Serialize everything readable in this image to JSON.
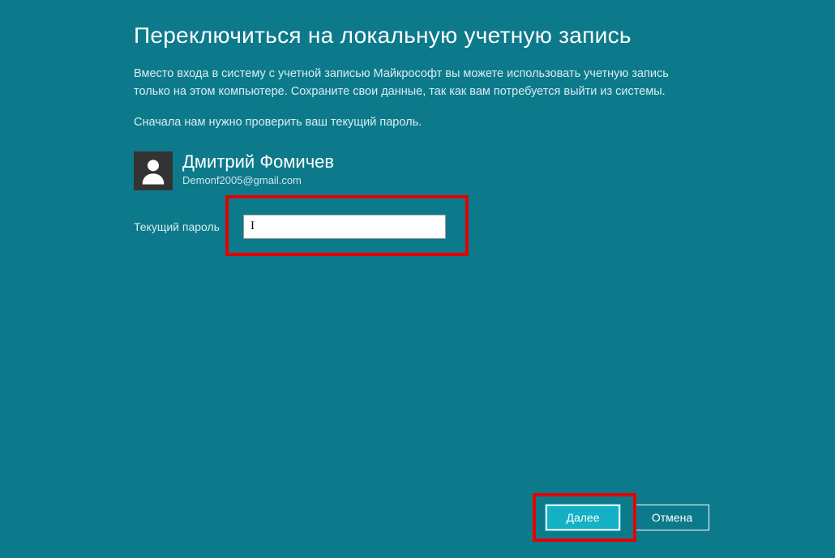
{
  "page": {
    "title": "Переключиться на локальную учетную запись",
    "description": "Вместо входа в систему с учетной записью Майкрософт вы можете использовать учетную запись только на этом компьютере. Сохраните свои данные, так как вам потребуется выйти из системы.",
    "subdescription": "Сначала нам нужно проверить ваш текущий пароль."
  },
  "user": {
    "name": "Дмитрий Фомичев",
    "email": "Demonf2005@gmail.com"
  },
  "form": {
    "password_label": "Текущий пароль",
    "password_value": ""
  },
  "buttons": {
    "next": "Далее",
    "cancel": "Отмена"
  }
}
